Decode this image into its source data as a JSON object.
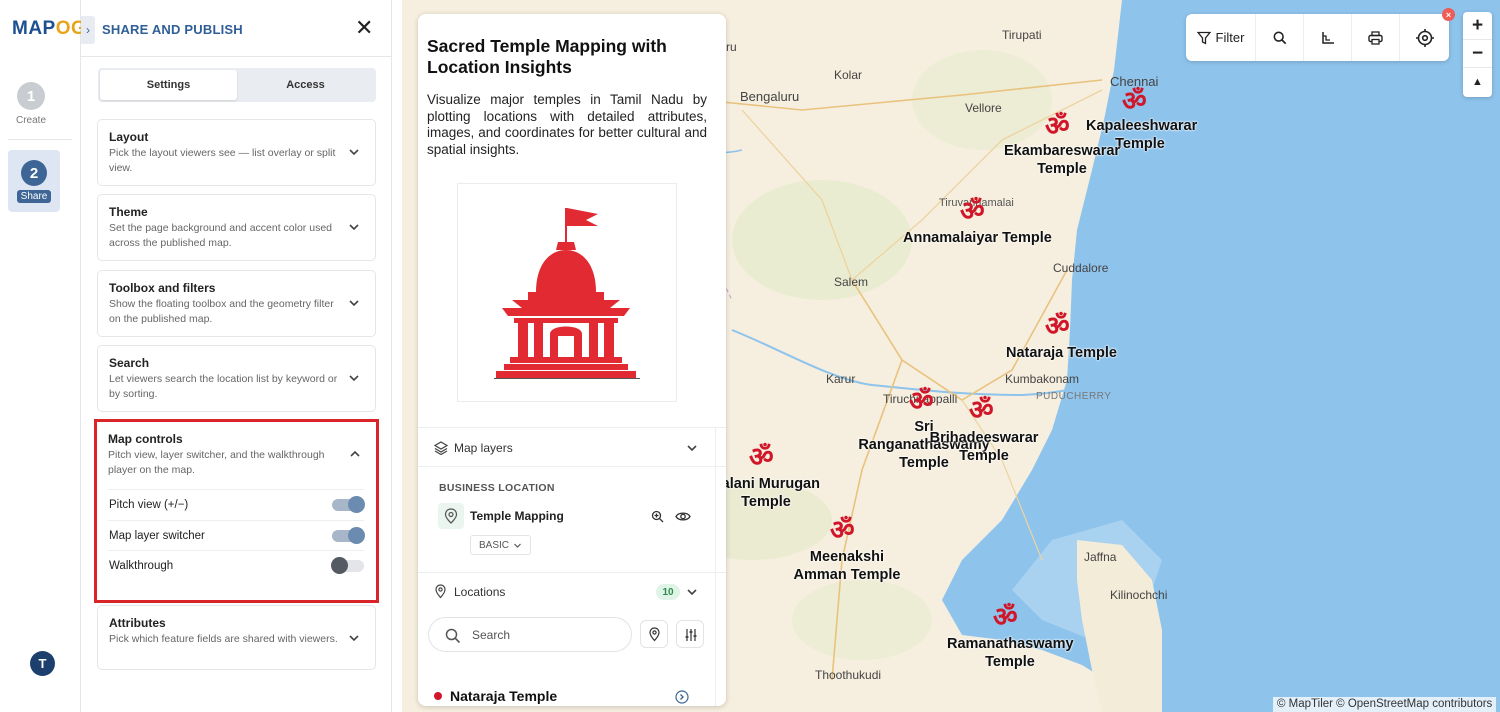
{
  "app": {
    "logo_main": "MAP",
    "logo_accent": "OG"
  },
  "steps": [
    {
      "number": "1",
      "label": "Create"
    },
    {
      "number": "2",
      "label": "Share"
    }
  ],
  "user": {
    "initial": "T"
  },
  "panel": {
    "title": "SHARE AND PUBLISH",
    "tabs": [
      {
        "label": "Settings",
        "active": true
      },
      {
        "label": "Access",
        "active": false
      }
    ],
    "sections": [
      {
        "title": "Layout",
        "description": "Pick the layout viewers see — list overlay or split view.",
        "expanded": false
      },
      {
        "title": "Theme",
        "description": "Set the page background and accent color used across the published map.",
        "expanded": false
      },
      {
        "title": "Toolbox and filters",
        "description": "Show the floating toolbox and the geometry filter on the published map.",
        "expanded": false
      },
      {
        "title": "Search",
        "description": "Let viewers search the location list by keyword or by sorting.",
        "expanded": false
      },
      {
        "title": "Map controls",
        "description": "Pitch view, layer switcher, and the walkthrough player on the map.",
        "expanded": true
      },
      {
        "title": "Attributes",
        "description": "Pick which feature fields are shared with viewers.",
        "expanded": false
      }
    ],
    "map_controls": [
      {
        "label": "Pitch view (+/−)",
        "on": true
      },
      {
        "label": "Map layer switcher",
        "on": true
      },
      {
        "label": "Walkthrough",
        "on": false
      }
    ],
    "highlight_color": "#d9252a"
  },
  "story": {
    "title": "Sacred Temple Mapping with Location Insights",
    "description": "Visualize major temples in Tamil Nadu by plotting locations with detailed attributes, images, and coordinates for better cultural and spatial insights.",
    "map_layers_label": "Map layers",
    "business_heading": "BUSINESS LOCATION",
    "layer_name": "Temple Mapping",
    "layer_style": "BASIC",
    "locations_label": "Locations",
    "locations_count": "10",
    "search_placeholder": "Search",
    "first_location": "Nataraja Temple"
  },
  "toolbar": {
    "filter_label": "Filter",
    "buttons": [
      "filter-icon",
      "search-icon",
      "measure-icon",
      "print-icon",
      "locate-icon"
    ]
  },
  "zoom": {
    "plus": "+",
    "minus": "−",
    "compass": "▲"
  },
  "map": {
    "marker_glyph": "ॐ",
    "marker_color": "#d1162a",
    "places": [
      "Tirupati",
      "Kolar",
      "Bengaluru",
      "Vellore",
      "Chennai",
      "Tiruvannamalai",
      "Salem",
      "Cuddalore",
      "Karur",
      "Tiruchirappalli",
      "Kumbakonam",
      "PUDUCHERRY",
      "Jaffna",
      "Kilinochchi",
      "Thoothukudi",
      "ru"
    ],
    "temples": [
      "Kapaleeshwarar Temple",
      "Ekambareswarar Temple",
      "Annamalaiyar Temple",
      "Nataraja Temple",
      "Sri Ranganathaswamy Temple",
      "Brihadeeswarar Temple",
      "Palani Murugan Temple",
      "Meenakshi Amman Temple",
      "Ramanathaswamy Temple"
    ],
    "attribution": "© MapTiler © OpenStreetMap contributors"
  }
}
